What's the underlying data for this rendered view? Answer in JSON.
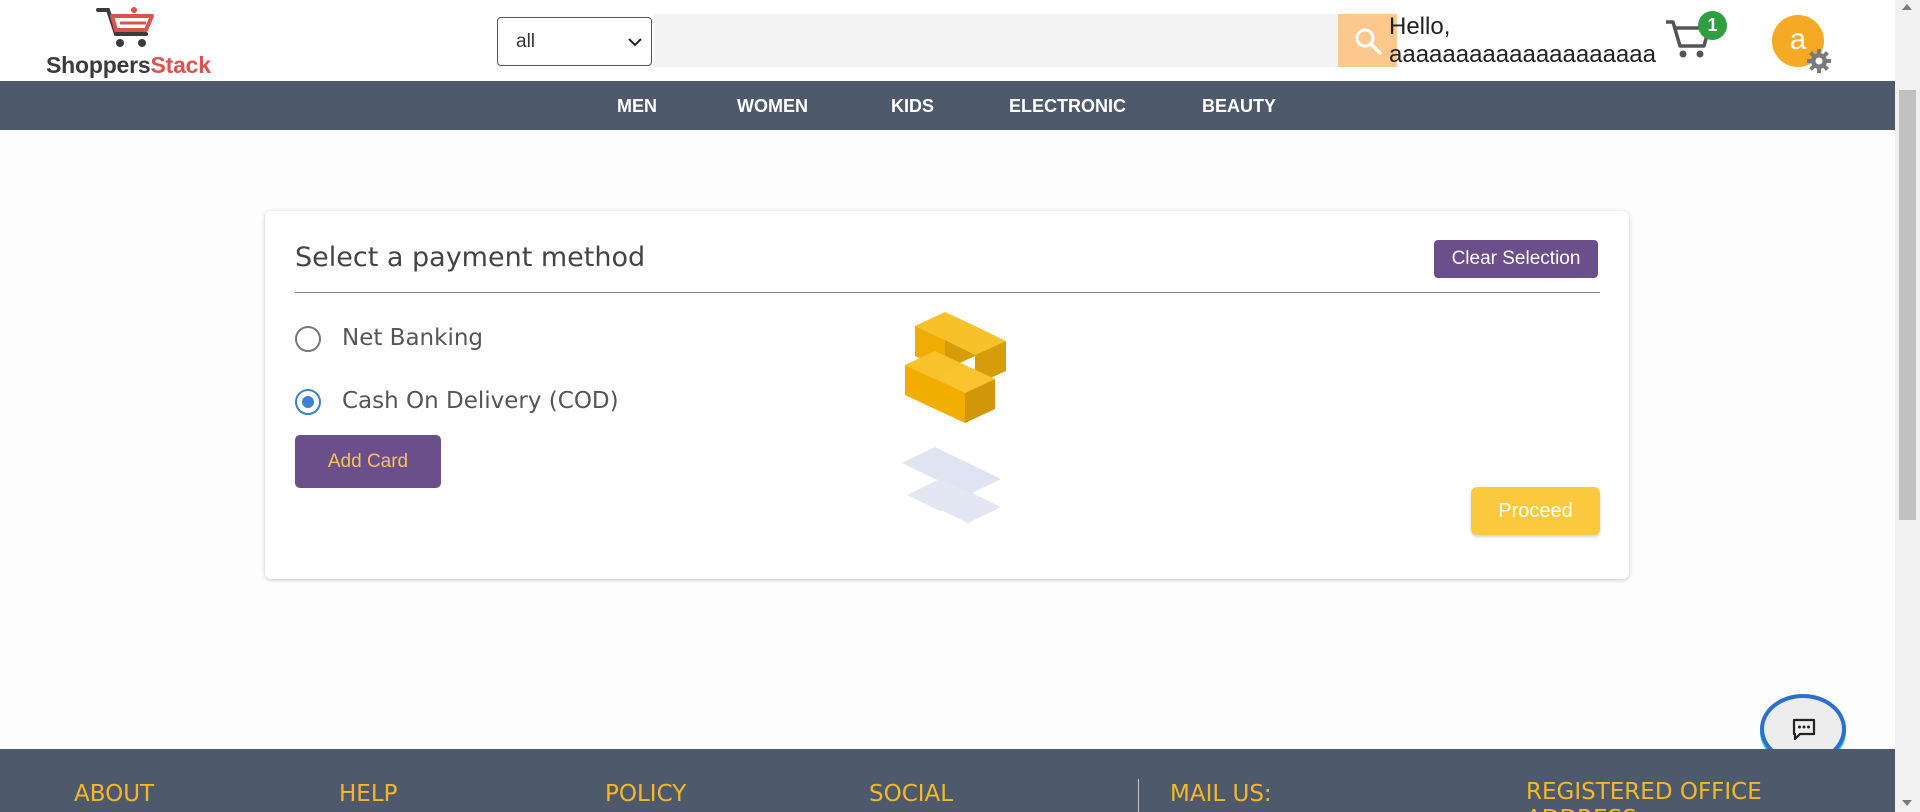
{
  "header": {
    "logo": {
      "part1": "Shoppers",
      "part2": "Stack"
    },
    "category_select": {
      "value": "all"
    },
    "search": {
      "value": ""
    },
    "greeting": {
      "line1": "Hello,",
      "line2": "aaaaaaaaaaaaaaaaaaaa"
    },
    "cart_count": "1",
    "avatar_initial": "a"
  },
  "nav": {
    "items": [
      {
        "label": "MEN"
      },
      {
        "label": "WOMEN"
      },
      {
        "label": "KIDS"
      },
      {
        "label": "ELECTRONIC"
      },
      {
        "label": "BEAUTY"
      }
    ]
  },
  "payment": {
    "title": "Select a payment method",
    "clear_label": "Clear Selection",
    "options": [
      {
        "label": "Net Banking",
        "checked": false
      },
      {
        "label": "Cash On Delivery (COD)",
        "checked": true
      }
    ],
    "add_card_label": "Add Card",
    "proceed_label": "Proceed"
  },
  "footer": {
    "headings": [
      {
        "label": "ABOUT"
      },
      {
        "label": "HELP"
      },
      {
        "label": "POLICY"
      },
      {
        "label": "SOCIAL"
      },
      {
        "label": "MAIL US:"
      },
      {
        "label": "REGISTERED OFFICE ADDRESS"
      }
    ]
  },
  "icons": {
    "logo": "cart-logo-icon",
    "select": "chevron-down-icon",
    "search": "search-icon",
    "cart": "cart-icon",
    "settings": "gear-icon",
    "chat": "chat-icon",
    "loader": "blocks-loader-icon"
  },
  "colors": {
    "nav_bg": "#4e5a6b",
    "primary_purple": "#6a4f8a",
    "accent_yellow": "#fbc93d",
    "footer_heading": "#f5b829",
    "radio_selected": "#3d80d6",
    "brand_red": "#d9534f"
  }
}
